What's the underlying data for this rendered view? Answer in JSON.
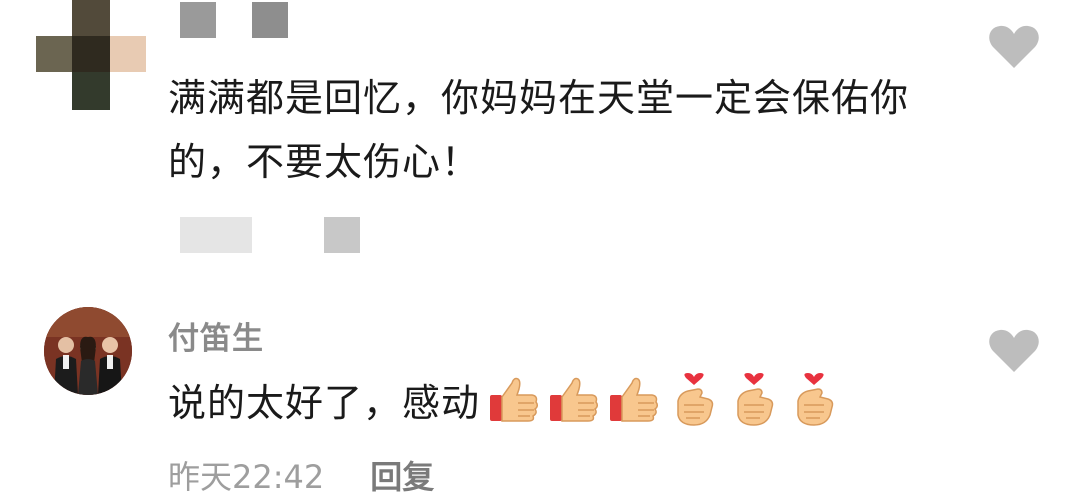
{
  "comments": [
    {
      "author": "",
      "text_line1": "满满都是回忆，你妈妈在天堂一定会保佑你",
      "text_line2": "的，不要太伤心！",
      "time": "",
      "reply": "",
      "like_icon": "heart-icon"
    },
    {
      "author": "付笛生",
      "text": "说的太好了，感动",
      "emojis": [
        "thumbs-up-icon",
        "thumbs-up-icon",
        "thumbs-up-icon",
        "finger-heart-icon",
        "finger-heart-icon",
        "finger-heart-icon"
      ],
      "time": "昨天22:42",
      "reply": "回复",
      "like_icon": "heart-icon"
    }
  ],
  "colors": {
    "text": "#1a1a1a",
    "username": "#8a8a8a",
    "meta": "#9e9e9e",
    "heart": "#bdbdbd"
  }
}
